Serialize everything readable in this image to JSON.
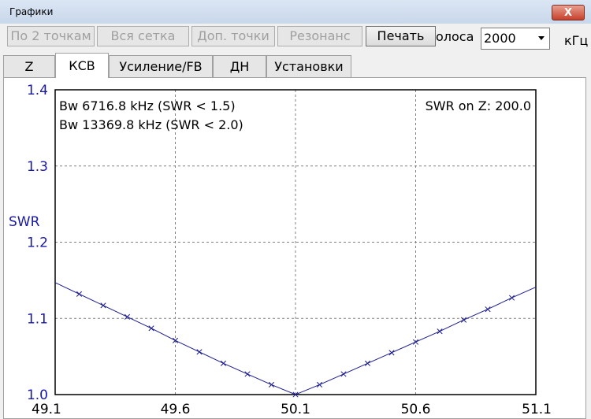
{
  "window": {
    "title": "Графики",
    "close_label": "X"
  },
  "toolbar": {
    "buttons": [
      {
        "label": "По 2 точкам",
        "enabled": false
      },
      {
        "label": "Вся сетка",
        "enabled": false
      },
      {
        "label": "Доп. точки",
        "enabled": false
      },
      {
        "label": "Резонанс",
        "enabled": false
      },
      {
        "label": "Печать",
        "enabled": true
      }
    ],
    "band_label": "олоса",
    "band_value": "2000",
    "unit_label": "кГц"
  },
  "tabs": [
    {
      "label": "Z",
      "active": false
    },
    {
      "label": "КСВ",
      "active": true
    },
    {
      "label": "Усиление/FB",
      "active": false
    },
    {
      "label": "ДН",
      "active": false
    },
    {
      "label": "Установки",
      "active": false
    }
  ],
  "chart_data": {
    "type": "line",
    "ylabel": "SWR",
    "xlabel": "",
    "xlim": [
      49.1,
      51.1
    ],
    "ylim": [
      1.0,
      1.4
    ],
    "xticks": [
      "49.1",
      "49.6",
      "50.1",
      "50.6",
      "51.1"
    ],
    "xtick_values": [
      49.1,
      49.6,
      50.1,
      50.6,
      51.1
    ],
    "yticks": [
      "1.0",
      "1.1",
      "1.2",
      "1.3",
      "1.4"
    ],
    "ytick_values": [
      1.0,
      1.1,
      1.2,
      1.3,
      1.4
    ],
    "grid": true,
    "annotations": {
      "bw1": "Bw 6716.8 kHz (SWR < 1.5)",
      "bw2": "Bw 13369.8 kHz (SWR < 2.0)",
      "z_ref": "SWR on Z: 200.0"
    },
    "colors": {
      "line": "#1a1a8c",
      "axis_text": "#1818a8",
      "grid": "#808080"
    },
    "series": [
      {
        "x": [
          49.1,
          49.2,
          49.3,
          49.4,
          49.5,
          49.6,
          49.7,
          49.8,
          49.9,
          50.0,
          50.1,
          50.2,
          50.3,
          50.4,
          50.5,
          50.6,
          50.7,
          50.8,
          50.9,
          51.0,
          51.1
        ],
        "y": [
          1.147,
          1.132,
          1.117,
          1.102,
          1.087,
          1.071,
          1.056,
          1.041,
          1.027,
          1.013,
          1.0,
          1.013,
          1.027,
          1.041,
          1.055,
          1.069,
          1.083,
          1.098,
          1.112,
          1.127,
          1.141
        ]
      }
    ]
  }
}
